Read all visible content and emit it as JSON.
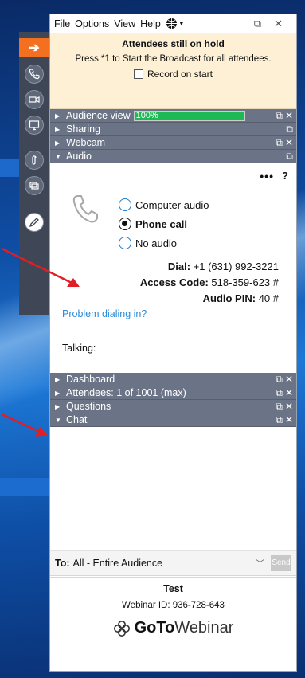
{
  "menubar": {
    "items": [
      "File",
      "Options",
      "View",
      "Help"
    ]
  },
  "hold_banner": {
    "title": "Attendees still on hold",
    "instruction": "Press *1 to Start the Broadcast for all attendees.",
    "record_label": "Record on start",
    "record_checked": false
  },
  "sections": {
    "audience_view": {
      "label": "Audience view",
      "progress_text": "100%",
      "progress": 1.0
    },
    "sharing": {
      "label": "Sharing"
    },
    "webcam": {
      "label": "Webcam"
    },
    "audio": {
      "label": "Audio"
    },
    "dashboard": {
      "label": "Dashboard"
    },
    "attendees": {
      "label": "Attendees: 1 of 1001 (max)"
    },
    "questions": {
      "label": "Questions"
    },
    "chat": {
      "label": "Chat"
    }
  },
  "audio": {
    "options": [
      "Computer audio",
      "Phone call",
      "No audio"
    ],
    "selected": "Phone call",
    "dial_label": "Dial:",
    "dial_value": "+1 (631) 992-3221",
    "access_label": "Access Code:",
    "access_value": "518-359-623 #",
    "pin_label": "Audio PIN:",
    "pin_value": "40 #",
    "problem_link": "Problem dialing in?",
    "talking_label": "Talking:",
    "more_label": "•••",
    "help_label": "?"
  },
  "chat": {
    "to_label": "To:",
    "to_value": "All - Entire Audience",
    "send_label": "Send"
  },
  "footer": {
    "webinar_title": "Test",
    "webinar_id": "Webinar ID: 936-728-643",
    "logo_bold": "GoTo",
    "logo_rest": "Webinar"
  },
  "colors": {
    "toolbar_bg": "#3f4756",
    "section_bg": "#6b7486",
    "hold_bg": "#fdf0d5",
    "progress_fill": "#1db954",
    "link": "#2d8bd6",
    "accent_orange": "#f37021",
    "annotation_arrow": "#e01e24"
  }
}
